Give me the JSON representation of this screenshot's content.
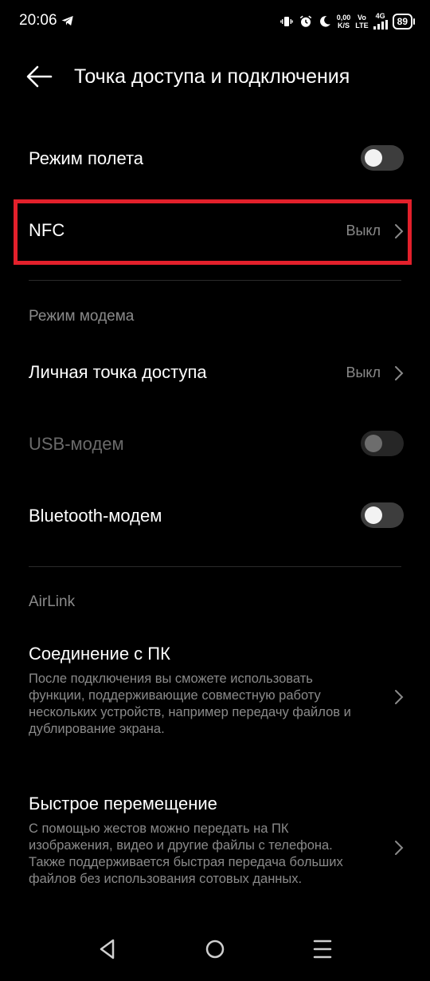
{
  "status_bar": {
    "time": "20:06",
    "net_speed_top": "0,00",
    "net_speed_bottom": "K/S",
    "volte_top": "Vo",
    "volte_bottom": "LTE",
    "signal_label": "4G",
    "battery": "89"
  },
  "header": {
    "title": "Точка доступа и подключения"
  },
  "rows": {
    "airplane": {
      "label": "Режим полета",
      "enabled": false
    },
    "nfc": {
      "label": "NFC",
      "value": "Выкл"
    },
    "hotspot": {
      "label": "Личная точка доступа",
      "value": "Выкл"
    },
    "usb_modem": {
      "label": "USB-модем",
      "enabled": false
    },
    "bt_modem": {
      "label": "Bluetooth-модем",
      "enabled": false
    },
    "pc_connection": {
      "label": "Соединение с ПК",
      "description": "После подключения вы сможете использовать функции, поддерживающие совместную работу нескольких устройств, например передачу файлов и дублирование экрана."
    },
    "quick_transfer": {
      "label": "Быстрое перемещение",
      "description": "С помощью жестов можно передать на ПК изображения, видео и другие файлы с телефона. Также поддерживается быстрая передача больших файлов без использования сотовых данных."
    }
  },
  "sections": {
    "modem": "Режим модема",
    "airlink": "AirLink"
  },
  "colors": {
    "background": "#000000",
    "highlight": "#e3202b",
    "secondary_text": "#8a8a8a"
  }
}
